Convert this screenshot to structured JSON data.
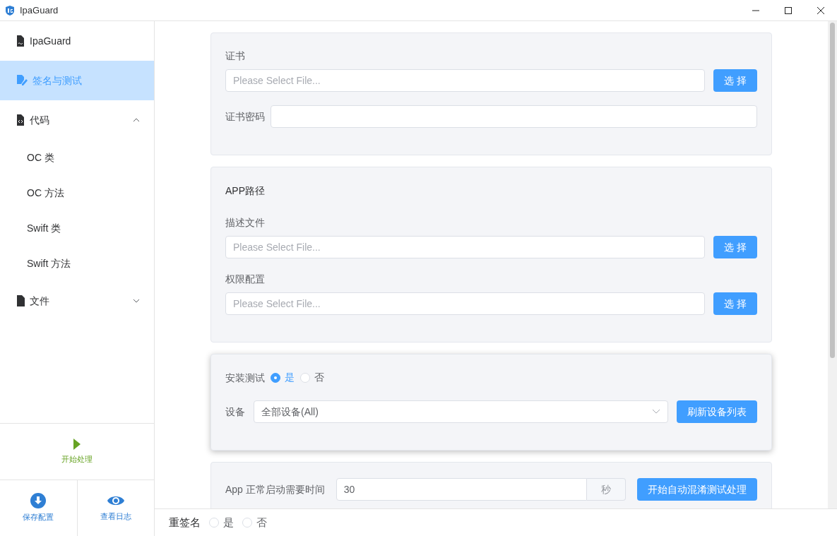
{
  "window": {
    "title": "IpaGuard"
  },
  "sidebar": {
    "items": [
      {
        "label": "IpaGuard",
        "kind": "doc-sign",
        "selected": false
      },
      {
        "label": "签名与测试",
        "kind": "edit",
        "selected": true
      },
      {
        "label": "代码",
        "kind": "doc-code",
        "selected": false,
        "expanded": true,
        "children": [
          {
            "label": "OC 类",
            "selected": false
          },
          {
            "label": "OC 方法",
            "selected": false
          },
          {
            "label": "Swift 类",
            "selected": false
          },
          {
            "label": "Swift 方法",
            "selected": false
          }
        ]
      },
      {
        "label": "文件",
        "kind": "doc",
        "selected": false,
        "expanded": false
      }
    ],
    "start_button": "开始处理",
    "actions": [
      {
        "label": "保存配置",
        "kind": "download"
      },
      {
        "label": "查看日志",
        "kind": "eye"
      }
    ]
  },
  "sections": [
    {
      "raised": false,
      "fields": [
        {
          "kind": "file",
          "label": "证书",
          "placeholder": "Please Select File...",
          "button": "选 择"
        },
        {
          "kind": "password",
          "label": "证书密码"
        }
      ]
    },
    {
      "raised": false,
      "heading": "APP路径",
      "fields": [
        {
          "kind": "file",
          "label": "描述文件",
          "placeholder": "Please Select File...",
          "button": "选 择"
        },
        {
          "kind": "file",
          "label": "权限配置",
          "placeholder": "Please Select File...",
          "button": "选 择"
        }
      ]
    },
    {
      "raised": true,
      "fields": [
        {
          "kind": "radio",
          "label": "安装测试",
          "options": [
            {
              "label": "是",
              "selected": true
            },
            {
              "label": "否",
              "selected": false
            }
          ]
        },
        {
          "kind": "select",
          "label": "设备",
          "value": "全部设备(All)",
          "button": "刷新设备列表"
        }
      ]
    },
    {
      "raised": false,
      "fields": [
        {
          "kind": "number",
          "label": "App 正常启动需要时间",
          "value": "30",
          "suffix": "秒",
          "button": "开始自动混淆测试处理"
        }
      ]
    }
  ],
  "bottom_bar": {
    "label": "重签名",
    "options": [
      {
        "label": "是",
        "selected": false
      },
      {
        "label": "否",
        "selected": false
      }
    ]
  }
}
